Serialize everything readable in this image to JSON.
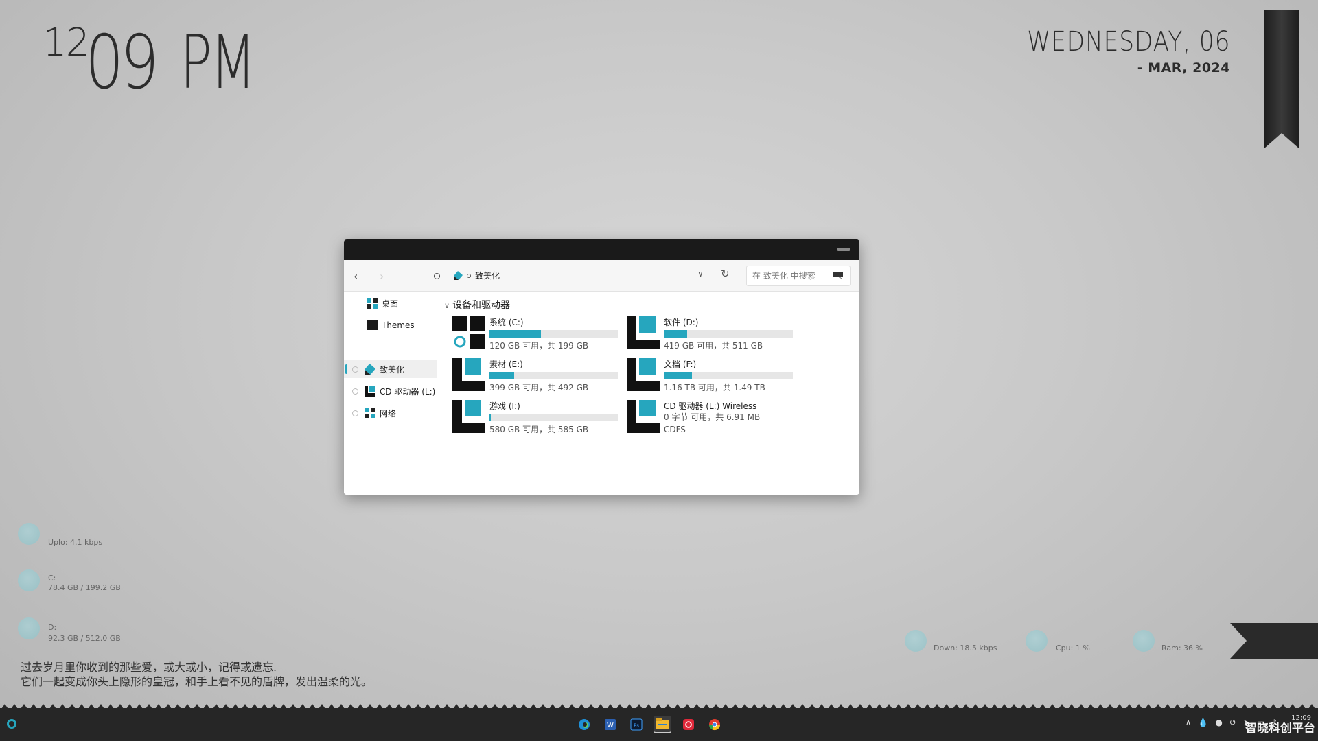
{
  "clock": {
    "hour": "12",
    "minute": "09",
    "ampm": "PM"
  },
  "date": {
    "day_line": "WEDNESDAY, 06",
    "month_line": "- MAR, 2024"
  },
  "explorer": {
    "breadcrumb": "致美化",
    "search_placeholder": "在 致美化 中搜索",
    "sidebar": {
      "quick": [
        {
          "label": "桌面"
        },
        {
          "label": "Themes"
        }
      ],
      "tree": [
        {
          "label": "致美化",
          "selected": true
        },
        {
          "label": "CD 驱动器 (L:)"
        },
        {
          "label": "网络"
        }
      ]
    },
    "section_title": "设备和驱动器",
    "drives": [
      {
        "name": "系统 (C:)",
        "info": "120 GB 可用，共 199 GB",
        "used_fraction": 0.4
      },
      {
        "name": "软件 (D:)",
        "info": "419 GB 可用，共 511 GB",
        "used_fraction": 0.18
      },
      {
        "name": "素材 (E:)",
        "info": "399 GB 可用，共 492 GB",
        "used_fraction": 0.19
      },
      {
        "name": "文档 (F:)",
        "info": "1.16 TB 可用，共 1.49 TB",
        "used_fraction": 0.22
      },
      {
        "name": "游戏 (I:)",
        "info": "580 GB 可用，共 585 GB",
        "used_fraction": 0.01
      },
      {
        "name": "CD 驱动器 (L:) Wireless",
        "info": "0 字节 可用，共 6.91 MB",
        "info2": "CDFS"
      }
    ]
  },
  "widgets": {
    "upload": {
      "label": "Uplo: 4.1 kbps"
    },
    "disk_c": {
      "label": "C:",
      "value": "78.4 GB / 199.2 GB"
    },
    "disk_d": {
      "label": "D:",
      "value": "92.3 GB / 512.0 GB"
    },
    "down": {
      "label": "Down: 18.5 kbps"
    },
    "cpu": {
      "label": "Cpu: 1 %"
    },
    "ram": {
      "label": "Ram: 36 %"
    }
  },
  "quote": {
    "line1": "过去岁月里你收到的那些爱，或大或小，记得或遗忘.",
    "line2": "它们一起变成你头上隐形的皇冠，和手上看不见的盾牌，发出温柔的光。"
  },
  "taskbar": {
    "apps": [
      "edge-icon",
      "word-icon",
      "photoshop-icon",
      "file-explorer-icon",
      "netease-music-icon",
      "chrome-icon"
    ],
    "clock": "12:09"
  },
  "watermark": "智晓科创平台",
  "colors": {
    "accent": "#26a6be",
    "taskbar": "#262626",
    "titlebar": "#1a1a1a"
  }
}
